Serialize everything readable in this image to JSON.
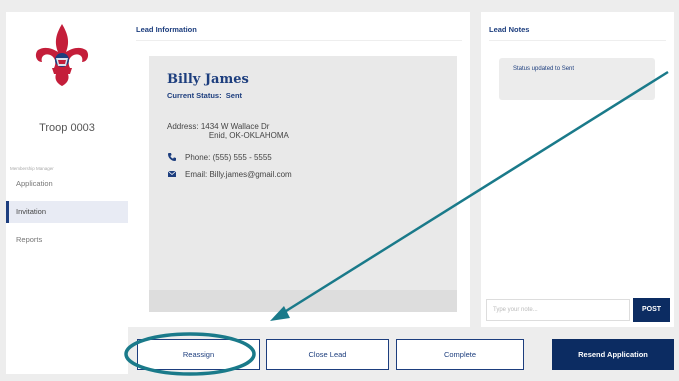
{
  "sidebar": {
    "troop_name": "Troop 0003",
    "section_label": "Membership Manager",
    "items": [
      {
        "label": "Application",
        "active": false
      },
      {
        "label": "Invitation",
        "active": true
      },
      {
        "label": "Reports",
        "active": false
      }
    ]
  },
  "lead": {
    "panel_title": "Lead Information",
    "name": "Billy James",
    "status_label": "Current Status:",
    "status_value": "Sent",
    "address_label": "Address:",
    "address_line1": "1434 W Wallace Dr",
    "address_line2": "Enid, OK-OKLAHOMA",
    "phone_label": "Phone:",
    "phone_value": "(555) 555 - 5555",
    "email_label": "Email:",
    "email_value": "Billy.james@gmail.com"
  },
  "notes": {
    "panel_title": "Lead Notes",
    "items": [
      {
        "text": "Status updated to Sent"
      }
    ],
    "input_placeholder": "Type your note...",
    "post_label": "POST"
  },
  "actions": {
    "reassign": "Reassign",
    "close_lead": "Close Lead",
    "complete": "Complete",
    "resend": "Resend Application"
  },
  "colors": {
    "brand_navy": "#0c2c62",
    "accent_blue": "#1d3e7e",
    "annotation_teal": "#1a7a8a"
  }
}
